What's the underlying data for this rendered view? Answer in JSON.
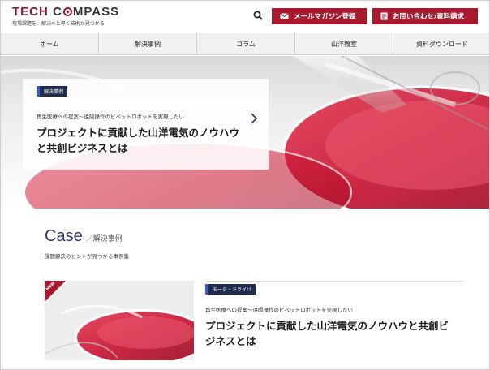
{
  "header": {
    "logo_text_tech": "Tech",
    "logo_text_c": "C",
    "logo_text_rest": "mpass",
    "tagline": "現場課題を、解決へと導く技術が見つかる",
    "mail_button": "メールマガジン登録",
    "contact_button": "お問い合わせ/資料請求"
  },
  "nav": {
    "items": [
      "ホーム",
      "解決事例",
      "コラム",
      "山洋教室",
      "資料ダウンロード"
    ]
  },
  "hero": {
    "tag": "解決事例",
    "subtitle": "再生医療への提案～遠隔操作のピペットロボットを実現したい",
    "title": "プロジェクトに貢献した山洋電気のノウハウと共創ビジネスとは"
  },
  "case_section": {
    "title_en": "Case",
    "title_ja": "／解決事例",
    "description": "課題解決のヒントが見つかる事例集"
  },
  "article": {
    "badge": "NEW",
    "tag": "モータ・ドライバ",
    "subtitle": "再生医療への提案～遠隔操作のピペットロボットを実現したい",
    "title": "プロジェクトに貢献した山洋電気のノウハウと共創ビジネスとは"
  },
  "colors": {
    "accent": "#a8182f",
    "tag_bg": "#1f2b4d",
    "tag_stripe": "#3b5bc7",
    "case_title": "#2d3a6b"
  }
}
